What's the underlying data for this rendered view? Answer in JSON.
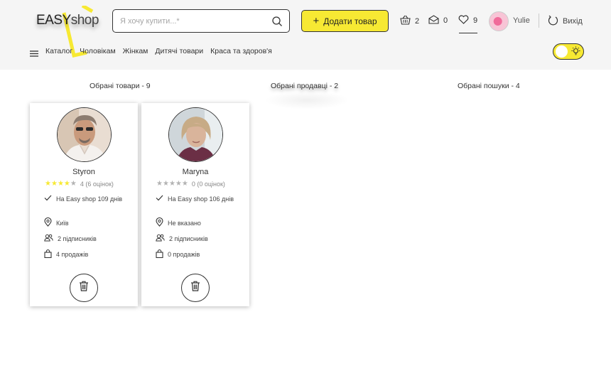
{
  "logo": {
    "text_main": "EASY",
    "text_shop": "shop"
  },
  "search": {
    "placeholder": "Я хочу купити...*"
  },
  "header": {
    "add_button_label": "Додати товар",
    "cart_count": "2",
    "messages_count": "0",
    "favorites_count": "9",
    "user_name": "Yulie",
    "logout_label": "Вихід"
  },
  "nav": {
    "items": [
      "Каталог",
      "Чоловікам",
      "Жінкам",
      "Дитячі товари",
      "Краса та здоров'я"
    ]
  },
  "tabs": {
    "products": "Обрані товари - 9",
    "sellers": "Обрані продавці - 2",
    "searches": "Обрані пошуки - 4"
  },
  "sellers": [
    {
      "name": "Styron",
      "stars_filled": 4,
      "rating_text": "4 (6 оцінок)",
      "days_text": "На Easy shop 109 днів",
      "city": "Київ",
      "followers": "2 підписників",
      "sales": "4 продажів"
    },
    {
      "name": "Maryna",
      "stars_filled": 0,
      "rating_text": "0 (0 оцінок)",
      "days_text": "На Easy shop 106 днів",
      "city": "Не вказано",
      "followers": "2 підписників",
      "sales": "0 продажів"
    }
  ],
  "colors": {
    "accent": "#f7e933",
    "header_bg": "#f5f5f5",
    "star_off": "#b3b3b3"
  }
}
